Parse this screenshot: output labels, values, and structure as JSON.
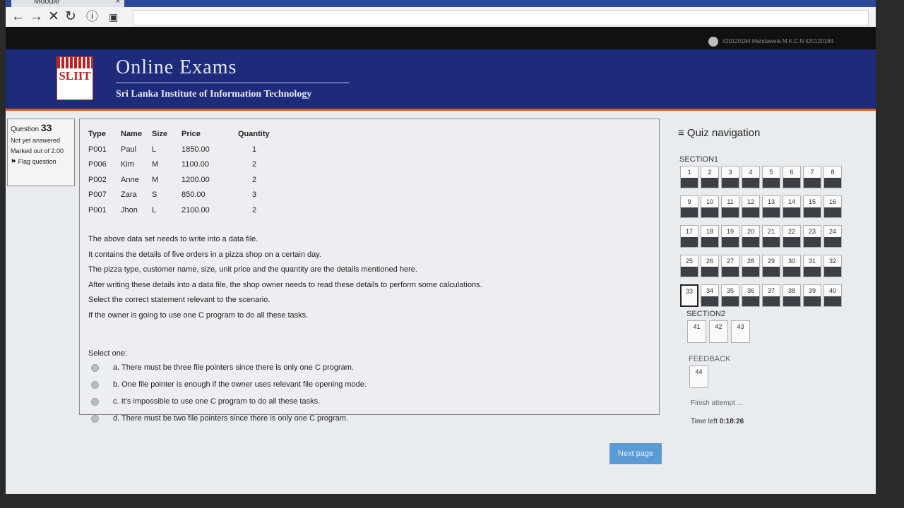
{
  "browser": {
    "tab_title": "Moodle",
    "tab_close": "×",
    "back": "←",
    "forward": "→",
    "stop": "✕",
    "reload": "↻",
    "info": "ⓘ"
  },
  "header": {
    "user": "it20120184 Mandawela M.K.C.N it20120184",
    "logo_text": "SLIIT",
    "site_title": "Online Exams",
    "site_subtitle": "Sri Lanka Institute of Information Technology"
  },
  "question_info": {
    "label": "Question",
    "number": "33",
    "status": "Not yet answered",
    "marked_out_of": "Marked out of 2.00",
    "flag": "Flag question"
  },
  "question": {
    "table_headers": [
      "Type",
      "Name",
      "Size",
      "Price",
      "Quantity"
    ],
    "rows": [
      [
        "P001",
        "Paul",
        "L",
        "1850.00",
        "1"
      ],
      [
        "P006",
        "Kim",
        "M",
        "1100.00",
        "2"
      ],
      [
        "P002",
        "Anne",
        "M",
        "1200.00",
        "2"
      ],
      [
        "P007",
        "Zara",
        "S",
        "850.00",
        "3"
      ],
      [
        "P001",
        "Jhon",
        "L",
        "2100.00",
        "2"
      ]
    ],
    "text_lines": [
      "The above data set needs to write into a data file.",
      "It contains the details of five orders in a pizza shop on a certain day.",
      "The pizza type, customer name, size, unit price and the quantity are the details mentioned here.",
      "After writing these details into a data file, the shop owner needs to read these details to perform some calculations.",
      "Select the correct statement relevant to the scenario.",
      "If the owner is going to use one C program to do all these tasks."
    ],
    "select_one": "Select one:",
    "options": [
      "a. There must be three file pointers since there is only one C program.",
      "b. One file pointer is enough if the owner uses relevant file opening mode.",
      "c. It's impossible to use one C program to do all these tasks.",
      "d. There must be two file pointers since there is only one C program."
    ],
    "next_page": "Next page"
  },
  "quiz_nav": {
    "title": "≡ Quiz navigation",
    "section1": "SECTION1",
    "section1_items": [
      "1",
      "2",
      "3",
      "4",
      "5",
      "6",
      "7",
      "8",
      "9",
      "10",
      "11",
      "12",
      "13",
      "14",
      "15",
      "16",
      "17",
      "18",
      "19",
      "20",
      "21",
      "22",
      "23",
      "24",
      "25",
      "26",
      "27",
      "28",
      "29",
      "30",
      "31",
      "32",
      "33",
      "34",
      "35",
      "36",
      "37",
      "38",
      "39",
      "40"
    ],
    "section2": "SECTION2",
    "section2_items": [
      "41",
      "42",
      "43"
    ],
    "feedback": "FEEDBACK",
    "feedback_items": [
      "44"
    ],
    "finish": "Finish attempt ...",
    "time_left_label": "Time left",
    "time_left": "0:18:26"
  }
}
